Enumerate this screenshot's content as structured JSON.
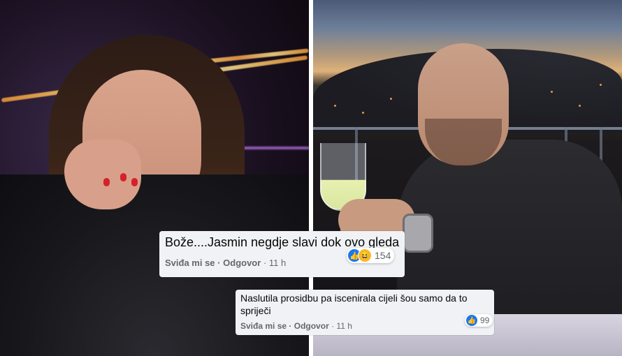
{
  "comments": [
    {
      "text": "Bože....Jasmin negdje slavi dok ovo gleda",
      "like_label": "Sviđa mi se",
      "reply_label": "Odgovor",
      "separator": "·",
      "time": "11 h",
      "reaction_count": "154",
      "reaction_icons": [
        "like-icon",
        "haha-icon"
      ]
    },
    {
      "text": "Naslutila prosidbu pa iscenirala cijeli šou samo da to spriječi",
      "like_label": "Sviđa mi se",
      "reply_label": "Odgovor",
      "separator": "·",
      "time": "11 h",
      "reaction_count": "99",
      "reaction_icons": [
        "like-icon"
      ]
    }
  ],
  "colors": {
    "comment_bg": "#f0f2f5",
    "like_blue": "#1877f2",
    "haha_yellow": "#f7b928",
    "meta_gray": "#65676b"
  }
}
